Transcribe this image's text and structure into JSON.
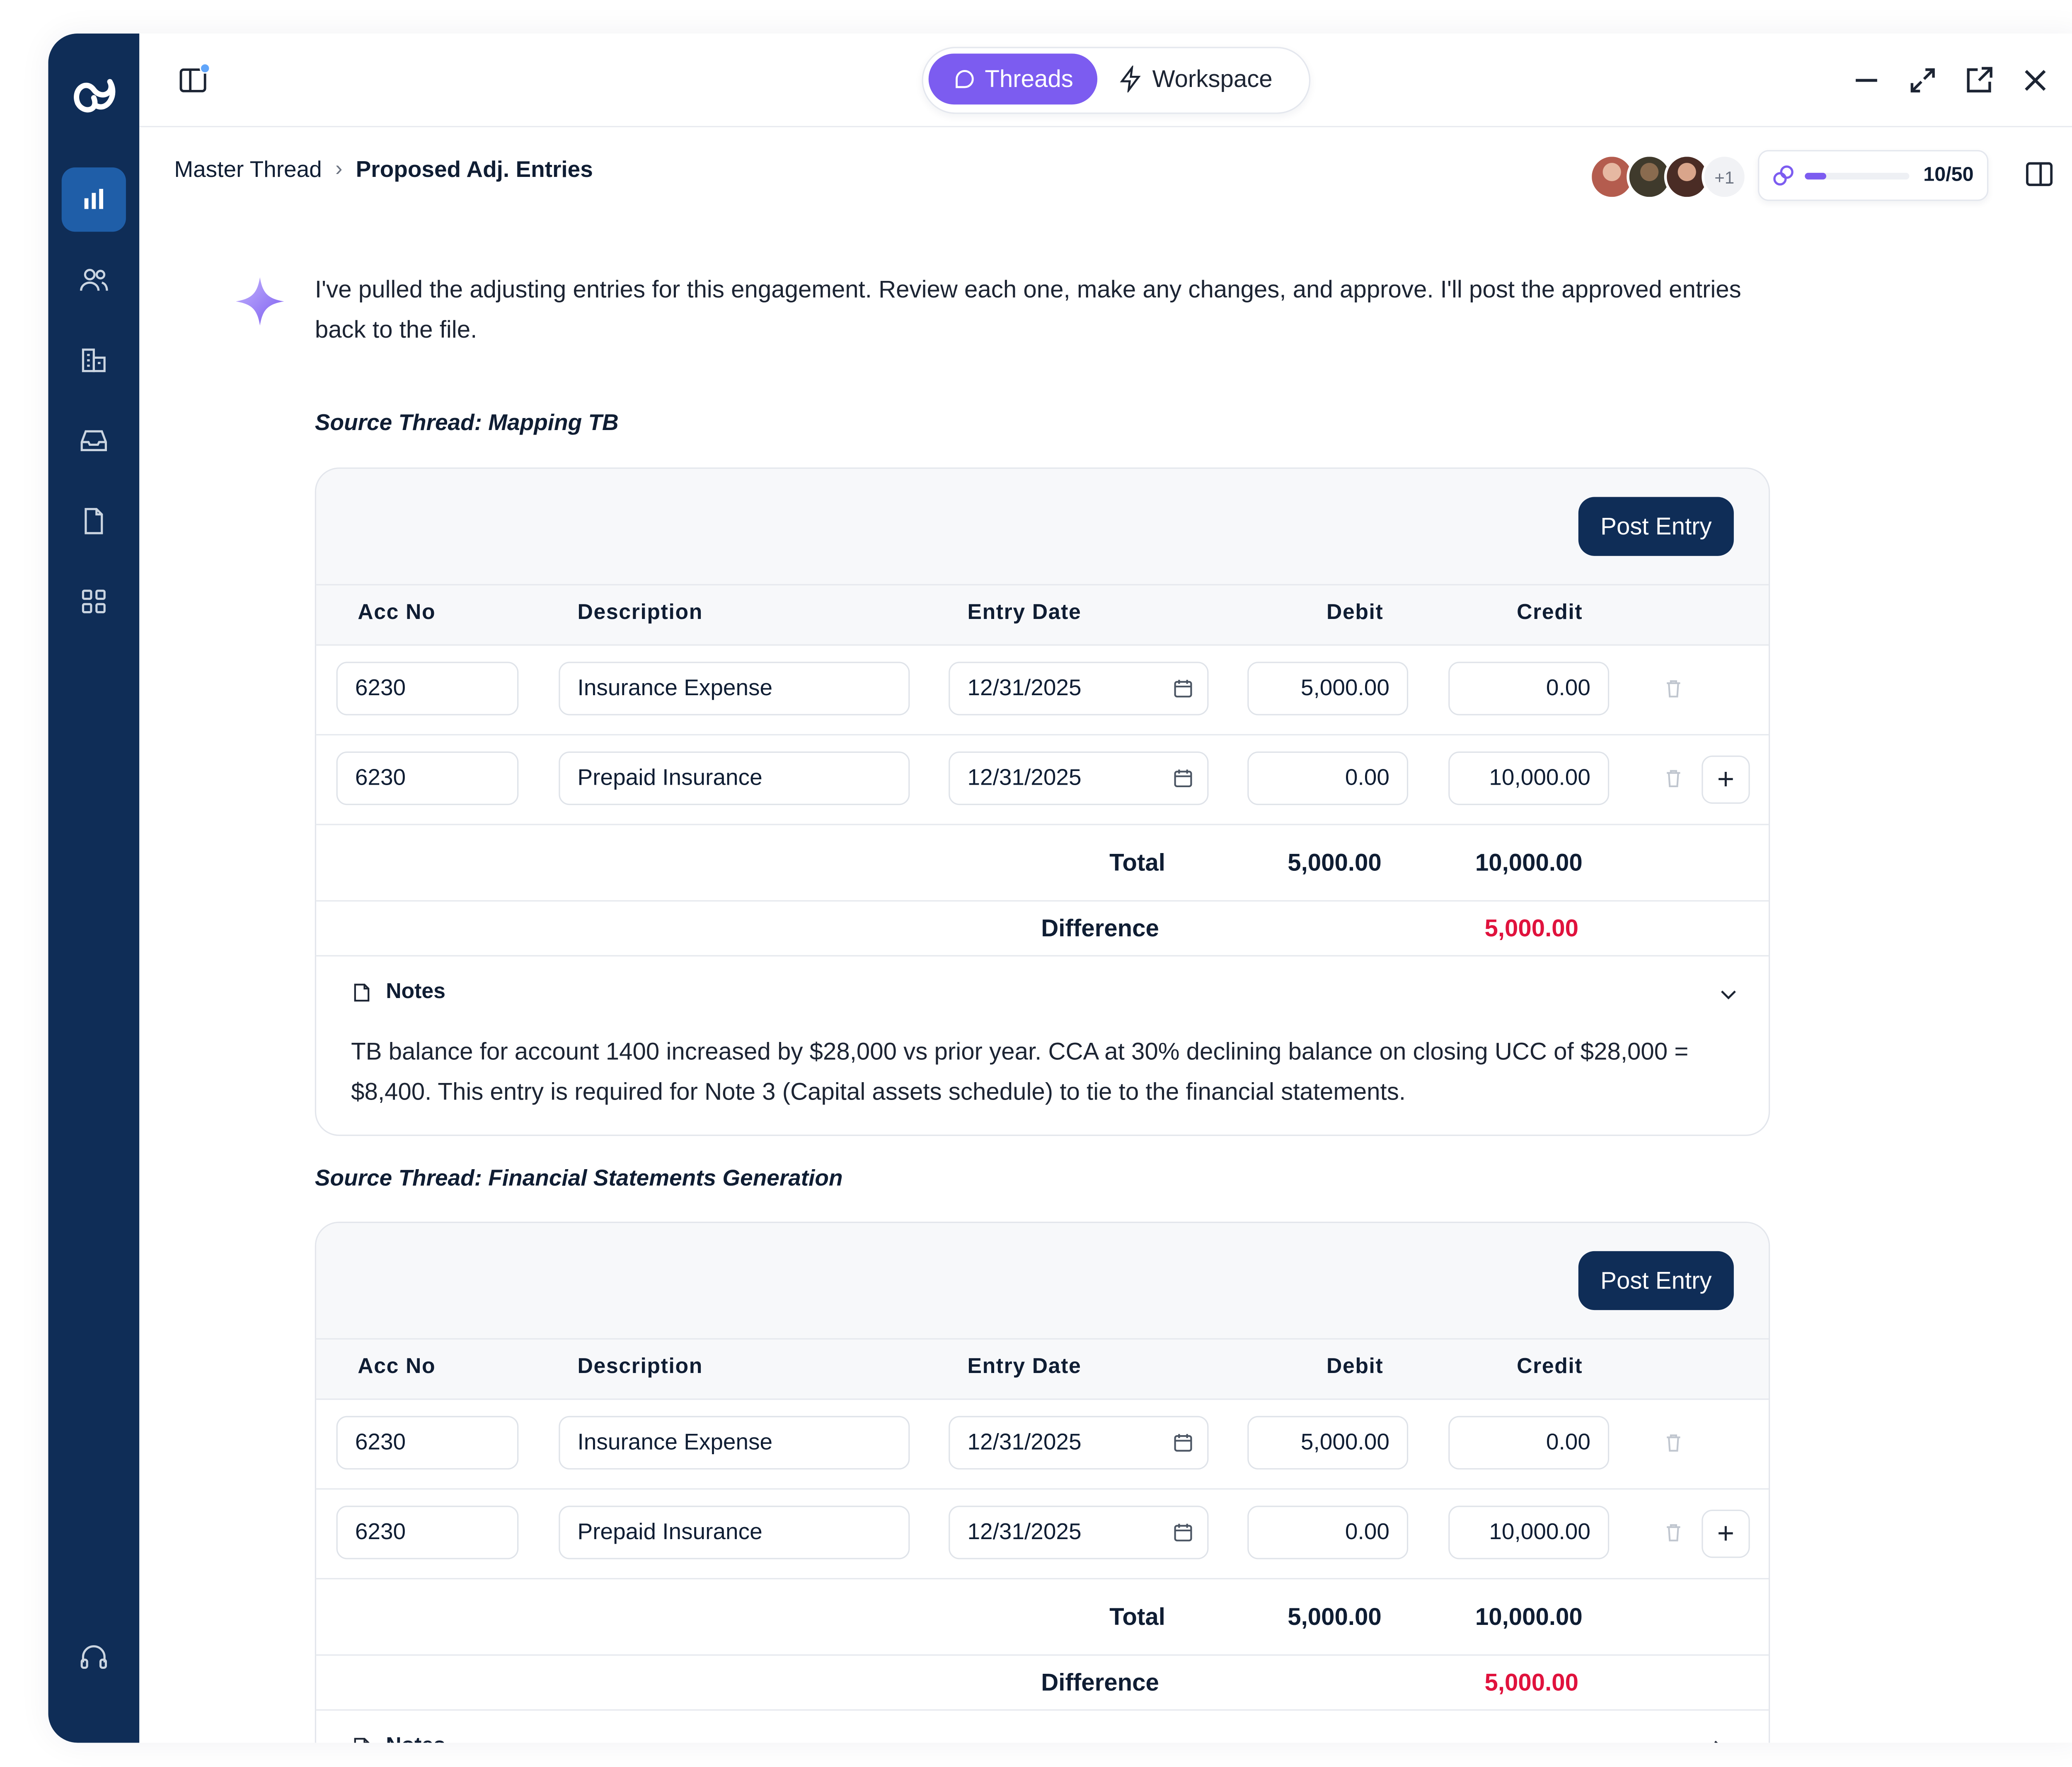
{
  "topbar": {
    "tabs": [
      {
        "label": "Threads",
        "active": true
      },
      {
        "label": "Workspace",
        "active": false
      }
    ]
  },
  "breadcrumb": {
    "root": "Master Thread",
    "current": "Proposed Adj. Entries"
  },
  "collaborators": {
    "extra": "+1"
  },
  "usage": {
    "label": "10/50",
    "fraction": 0.2
  },
  "message": "I've pulled the adjusting entries for this engagement. Review each one, make any changes, and approve. I'll post the approved entries back to the file.",
  "columns": {
    "acc": "Acc No",
    "desc": "Description",
    "date": "Entry Date",
    "debit": "Debit",
    "credit": "Credit"
  },
  "post_label": "Post Entry",
  "total_label": "Total",
  "difference_label": "Difference",
  "notes_label": "Notes",
  "entries": [
    {
      "source": "Source Thread: Mapping TB",
      "rows": [
        {
          "acc": "6230",
          "desc": "Insurance Expense",
          "date": "12/31/2025",
          "debit": "5,000.00",
          "credit": "0.00"
        },
        {
          "acc": "6230",
          "desc": "Prepaid Insurance",
          "date": "12/31/2025",
          "debit": "0.00",
          "credit": "10,000.00"
        }
      ],
      "total_debit": "5,000.00",
      "total_credit": "10,000.00",
      "difference": "5,000.00",
      "notes": "TB balance for account 1400 increased by $28,000 vs prior year. CCA at 30% declining balance on closing UCC of $28,000 = $8,400. This entry is required for Note 3 (Capital assets schedule) to tie to the financial statements."
    },
    {
      "source": "Source Thread: Financial Statements Generation",
      "rows": [
        {
          "acc": "6230",
          "desc": "Insurance Expense",
          "date": "12/31/2025",
          "debit": "5,000.00",
          "credit": "0.00"
        },
        {
          "acc": "6230",
          "desc": "Prepaid Insurance",
          "date": "12/31/2025",
          "debit": "0.00",
          "credit": "10,000.00"
        }
      ],
      "total_debit": "5,000.00",
      "total_credit": "10,000.00",
      "difference": "5,000.00"
    }
  ],
  "colors": {
    "accent": "#7c5cf0",
    "navy": "#0f2d57",
    "danger": "#e0123d"
  }
}
